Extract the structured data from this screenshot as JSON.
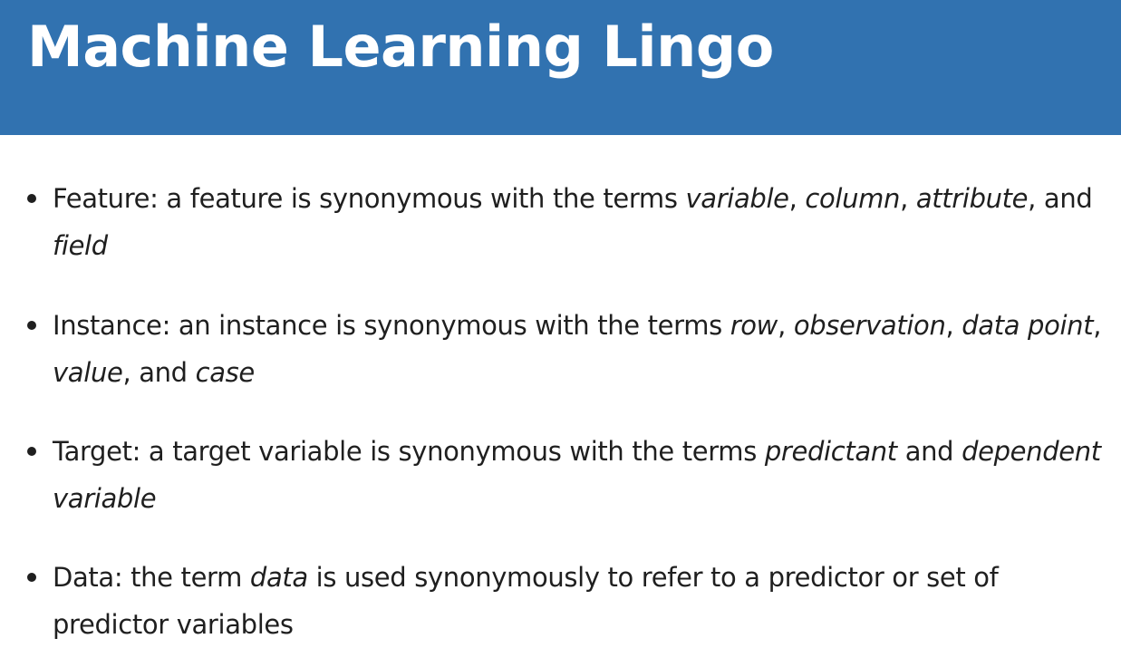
{
  "slide": {
    "title": "Machine Learning Lingo",
    "accent_color": "#3172b0"
  },
  "bullets": [
    {
      "term": "Feature",
      "t1": ": a feature is synonymous with the terms ",
      "e1": "variable",
      "t2": ", ",
      "e2": "column",
      "t3": ", ",
      "e3": "attribute",
      "t4": ", and ",
      "e4": "field"
    },
    {
      "term": "Instance",
      "t1": ": an instance is synonymous with the terms ",
      "e1": "row",
      "t2": ", ",
      "e2": "observation",
      "t3": ", ",
      "e3": "data point",
      "t4": ", ",
      "e4": "value",
      "t5": ", and ",
      "e5": "case"
    },
    {
      "term": "Target",
      "t1": ": a target variable is synonymous with the terms ",
      "e1": "predictant",
      "t2": " and ",
      "e2": "dependent variable"
    },
    {
      "term": "Data",
      "t1": ": the term ",
      "e1": "data",
      "t2": " is used synonymously to refer to a predictor or set of predictor variables"
    }
  ]
}
